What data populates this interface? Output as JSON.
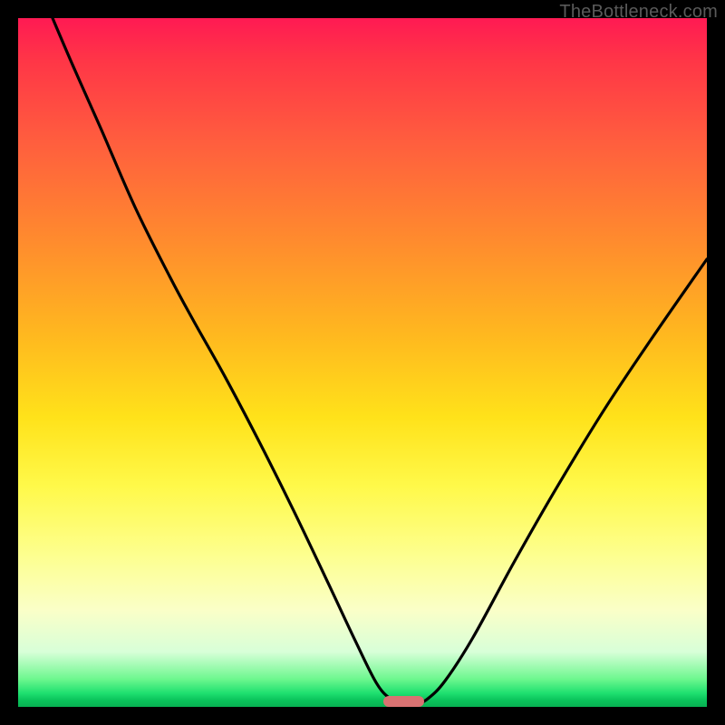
{
  "watermark": "TheBottleneck.com",
  "chart_data": {
    "type": "line",
    "title": "",
    "xlabel": "",
    "ylabel": "",
    "xlim": [
      0,
      100
    ],
    "ylim": [
      0,
      100
    ],
    "legend": false,
    "grid": false,
    "gradient_stops": [
      {
        "pct": 0,
        "color": "#ff1a53"
      },
      {
        "pct": 6,
        "color": "#ff3547"
      },
      {
        "pct": 18,
        "color": "#ff5e3e"
      },
      {
        "pct": 32,
        "color": "#ff8a2e"
      },
      {
        "pct": 46,
        "color": "#ffb81f"
      },
      {
        "pct": 58,
        "color": "#ffe21a"
      },
      {
        "pct": 68,
        "color": "#fff94a"
      },
      {
        "pct": 78,
        "color": "#fdff8f"
      },
      {
        "pct": 86,
        "color": "#faffc8"
      },
      {
        "pct": 92,
        "color": "#d8ffd8"
      },
      {
        "pct": 96,
        "color": "#6cf78e"
      },
      {
        "pct": 98,
        "color": "#1fe070"
      },
      {
        "pct": 99,
        "color": "#0ac45c"
      },
      {
        "pct": 100,
        "color": "#08b052"
      }
    ],
    "series": [
      {
        "name": "bottleneck-curve",
        "color": "#000000",
        "points": [
          {
            "x": 5.0,
            "y": 100.0
          },
          {
            "x": 8.0,
            "y": 93.0
          },
          {
            "x": 12.0,
            "y": 84.0
          },
          {
            "x": 17.0,
            "y": 72.5
          },
          {
            "x": 22.0,
            "y": 62.5
          },
          {
            "x": 25.5,
            "y": 56.0
          },
          {
            "x": 30.0,
            "y": 48.0
          },
          {
            "x": 35.0,
            "y": 38.5
          },
          {
            "x": 40.0,
            "y": 28.5
          },
          {
            "x": 45.0,
            "y": 18.0
          },
          {
            "x": 49.0,
            "y": 9.5
          },
          {
            "x": 52.0,
            "y": 3.5
          },
          {
            "x": 54.0,
            "y": 1.2
          },
          {
            "x": 55.5,
            "y": 0.6
          },
          {
            "x": 58.0,
            "y": 0.6
          },
          {
            "x": 59.5,
            "y": 1.2
          },
          {
            "x": 62.0,
            "y": 3.8
          },
          {
            "x": 66.0,
            "y": 10.0
          },
          {
            "x": 72.0,
            "y": 21.0
          },
          {
            "x": 78.0,
            "y": 31.5
          },
          {
            "x": 85.0,
            "y": 43.0
          },
          {
            "x": 92.0,
            "y": 53.5
          },
          {
            "x": 100.0,
            "y": 65.0
          }
        ]
      }
    ],
    "marker": {
      "name": "optimal-range",
      "x_start": 53.0,
      "x_end": 59.0,
      "y": 0.8,
      "color": "#d97272"
    }
  }
}
